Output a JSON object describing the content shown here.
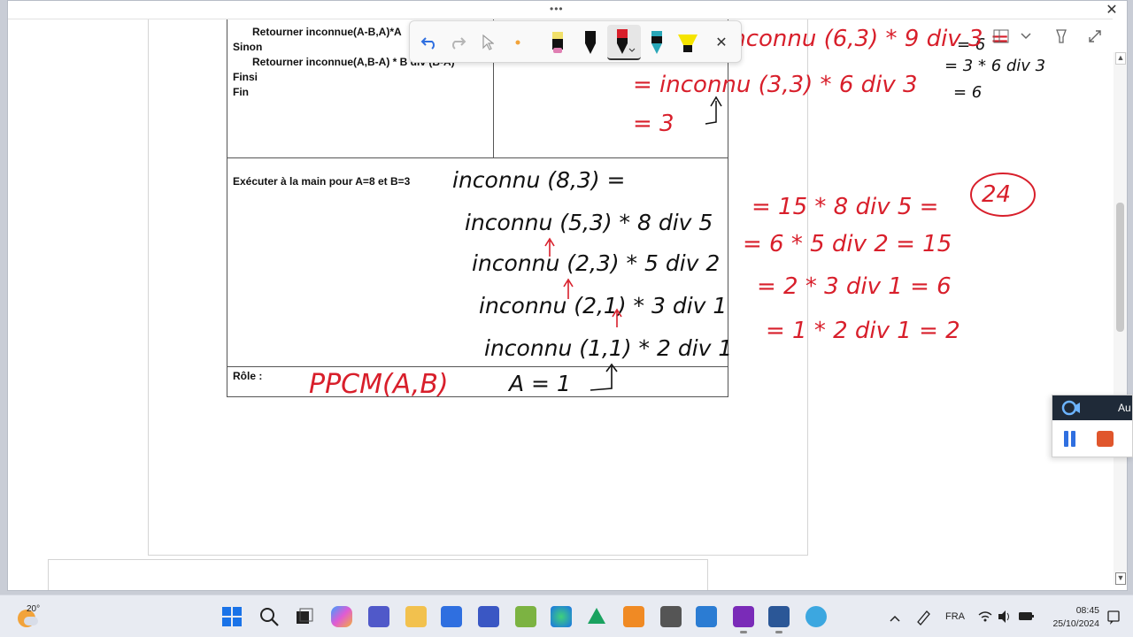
{
  "window": {
    "title_dots": "•••",
    "close_glyph": "✕"
  },
  "document": {
    "code_lines": [
      "Retourner inconnue(A-B,A)*A",
      "Sinon",
      "Retourner inconnue(A,B-A) * B div (B-A)",
      "Finsi",
      "Fin"
    ],
    "exec_label": "Exécuter à la main pour A=8 et B=3",
    "role_label": "Rôle :"
  },
  "ink": {
    "black": {
      "l1": "inconnu (8,3) =",
      "l2": "inconnu (5,3) * 8 div 5",
      "l3": "inconnu (2,3) * 5 div 2",
      "l4": "inconnu (2,1) * 3   div 1",
      "l5": "inconnu (1,1) * 2 div 1",
      "a1": "A = 1",
      "top_right_1": "= 6",
      "top_right_2": "= 3 * 6 div 3",
      "top_right_3": "= 6"
    },
    "red": {
      "top1": "inconnu (6,3) * 9 div 3 =",
      "top2": "= inconnu  (3,3) * 6 div 3",
      "top3": "= 3",
      "r2": "= 15 * 8 div 5 =",
      "r2_circle": "24",
      "r3": "= 6 * 5 div 2 = 15",
      "r4": "= 2 * 3 div 1 = 6",
      "r5": "= 1 * 2 div 1 = 2",
      "role": "PPCM(A,B)"
    }
  },
  "pen_toolbar": {
    "undo": "undo-icon",
    "redo": "redo-icon",
    "cursor": "cursor-icon",
    "dot": "lasso-dot",
    "pens": [
      "pink-pen",
      "black-pen",
      "red-pen",
      "teal-pen",
      "yellow-highlighter"
    ],
    "close": "✕"
  },
  "recorder": {
    "label": "Au"
  },
  "taskbar": {
    "temperature": "20°",
    "lang": "FRA",
    "time": "08:45",
    "date": "25/10/2024"
  },
  "colors": {
    "ink_red": "#d81f2b",
    "ink_black": "#111111",
    "accent": "#2f6fe0"
  }
}
